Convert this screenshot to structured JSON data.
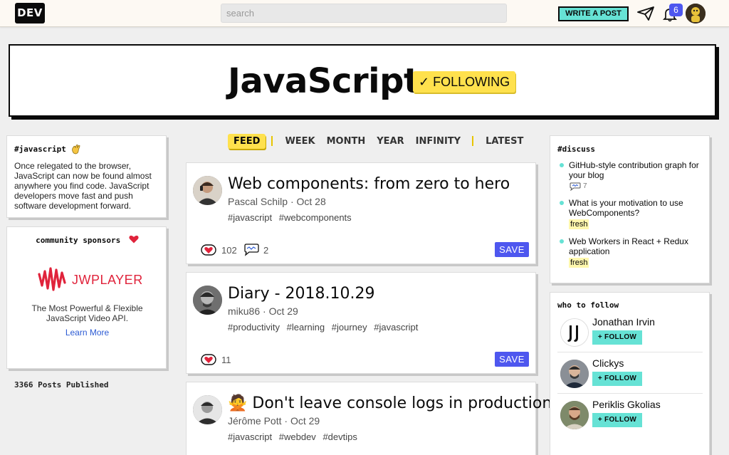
{
  "header": {
    "logo": "DEV",
    "search_placeholder": "search",
    "write_post": "WRITE A POST",
    "notification_count": "6",
    "icons": [
      "send-icon",
      "bell-icon"
    ]
  },
  "tag": {
    "title": "JavaScript",
    "following_label": "✓ FOLLOWING",
    "accent_color": "#ffe14d"
  },
  "about": {
    "title": "#javascript",
    "text": "Once relegated to the browser, JavaScript can now be found almost anywhere you find code. JavaScript developers move fast and push software development forward."
  },
  "sponsors": {
    "title": "community sponsors",
    "brand": "JWPLAYER",
    "tagline": "The Most Powerful & Flexible JavaScript Video API.",
    "link": "Learn More"
  },
  "posts_published": "3366 Posts Published",
  "feed_tabs": {
    "feed": "FEED",
    "week": "WEEK",
    "month": "MONTH",
    "year": "YEAR",
    "infinity": "INFINITY",
    "latest": "LATEST"
  },
  "articles": [
    {
      "title": "Web components: from zero to hero",
      "author": "Pascal Schilp",
      "date": "Oct 28",
      "tags": [
        "#javascript",
        "#webcomponents"
      ],
      "reactions": "102",
      "comments": "2",
      "save": "SAVE"
    },
    {
      "title": "Diary - 2018.10.29",
      "author": "miku86",
      "date": "Oct 29",
      "tags": [
        "#productivity",
        "#learning",
        "#journey",
        "#javascript"
      ],
      "reactions": "11",
      "save": "SAVE"
    },
    {
      "title": "🙅 Don't leave console logs in production",
      "author": "Jérôme Pott",
      "date": "Oct 29",
      "tags": [
        "#javascript",
        "#webdev",
        "#devtips"
      ]
    }
  ],
  "discuss": {
    "title": "#discuss",
    "items": [
      {
        "title": "GitHub-style contribution graph for your blog",
        "comments": "7"
      },
      {
        "title": "What is your motivation to use WebComponents?",
        "badge": "fresh"
      },
      {
        "title": "Web Workers in React + Redux application",
        "badge": "fresh"
      }
    ]
  },
  "who_to_follow": {
    "title": "who to follow",
    "follow_label": "+ FOLLOW",
    "users": [
      {
        "name": "Jonathan Irvin"
      },
      {
        "name": "Clickys"
      },
      {
        "name": "Periklis Gkolias"
      }
    ]
  }
}
